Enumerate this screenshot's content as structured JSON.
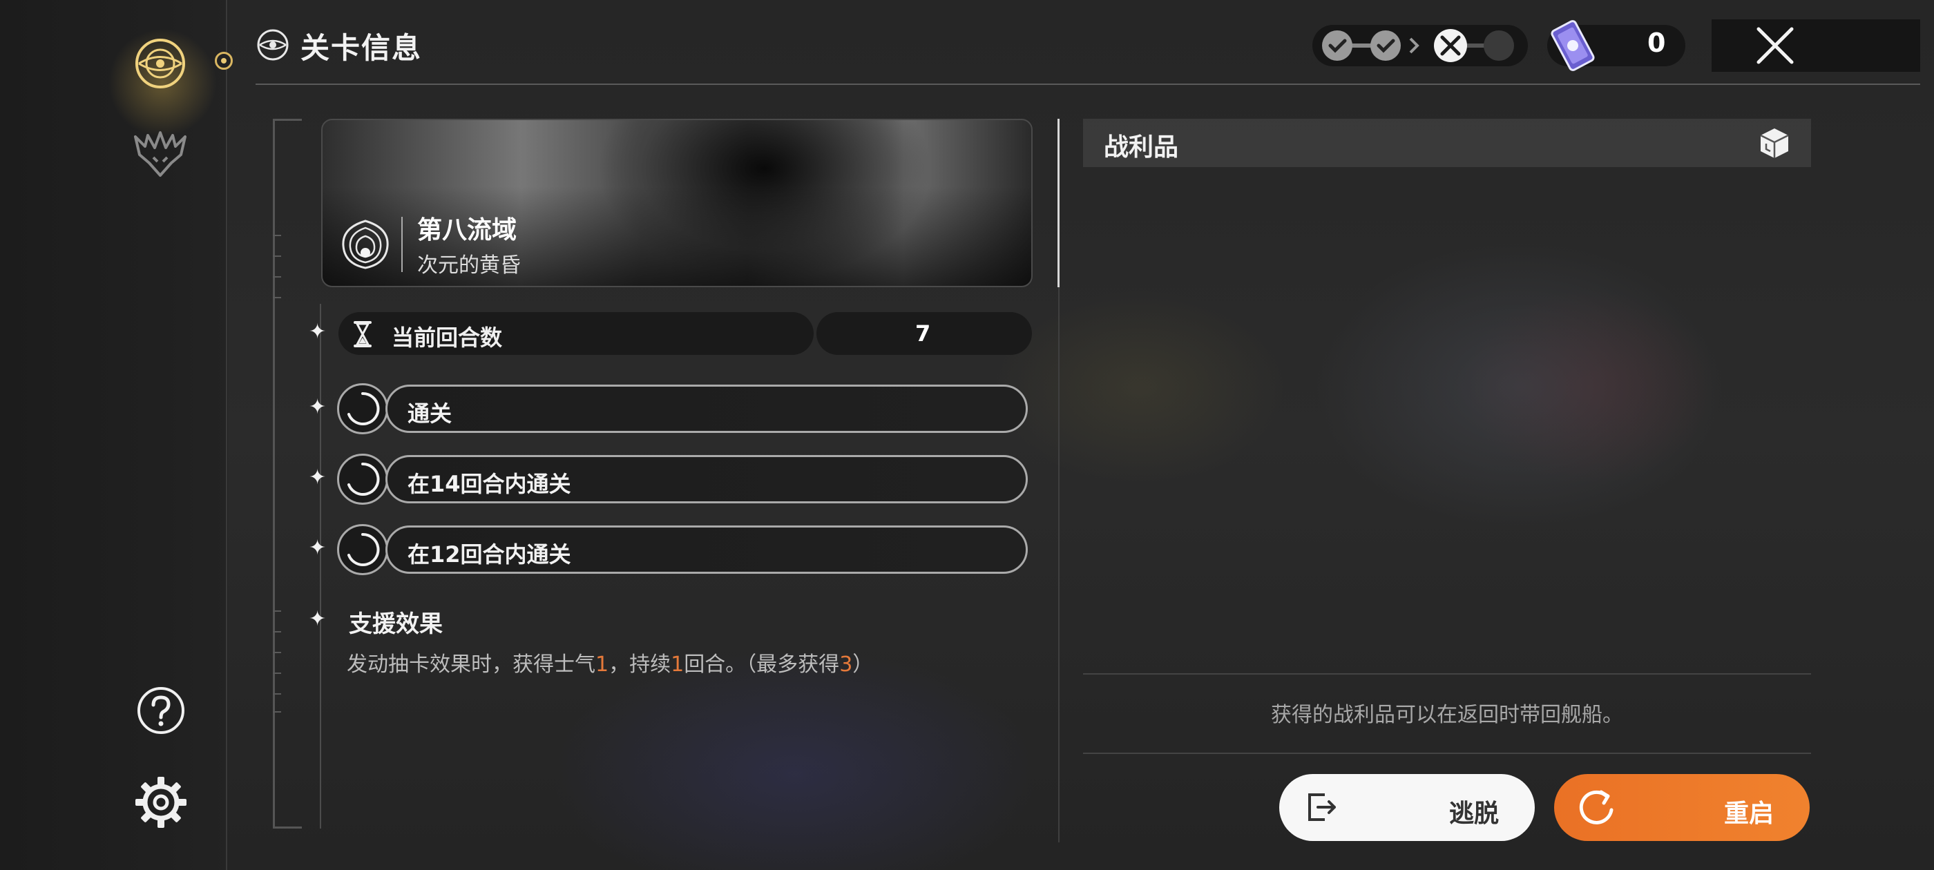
{
  "header": {
    "title": "关卡信息"
  },
  "top_bar": {
    "stage_progress": {
      "completed_nodes": 2,
      "battle_node": 1,
      "remaining_nodes": 1
    },
    "currency_value": "0"
  },
  "stage": {
    "name": "第八流域",
    "subtitle": "次元的黄昏"
  },
  "turns": {
    "label": "当前回合数",
    "value": "7"
  },
  "objectives": [
    {
      "label": "通关"
    },
    {
      "label": "在14回合内通关"
    },
    {
      "label": "在12回合内通关"
    }
  ],
  "support": {
    "title": "支援效果",
    "desc_part1": "发动抽卡效果时，获得士气",
    "desc_num1": "1",
    "desc_part2": "，持续",
    "desc_num2": "1",
    "desc_part3": "回合。（最多获得",
    "desc_num3": "3",
    "desc_part4": "）"
  },
  "loot": {
    "title": "战利品",
    "note": "获得的战利品可以在返回时带回舰船。"
  },
  "buttons": {
    "escape": "逃脱",
    "restart": "重启"
  },
  "colors": {
    "accent": "#f0822e",
    "highlight": "#e5793a",
    "gold": "#e9c873"
  }
}
